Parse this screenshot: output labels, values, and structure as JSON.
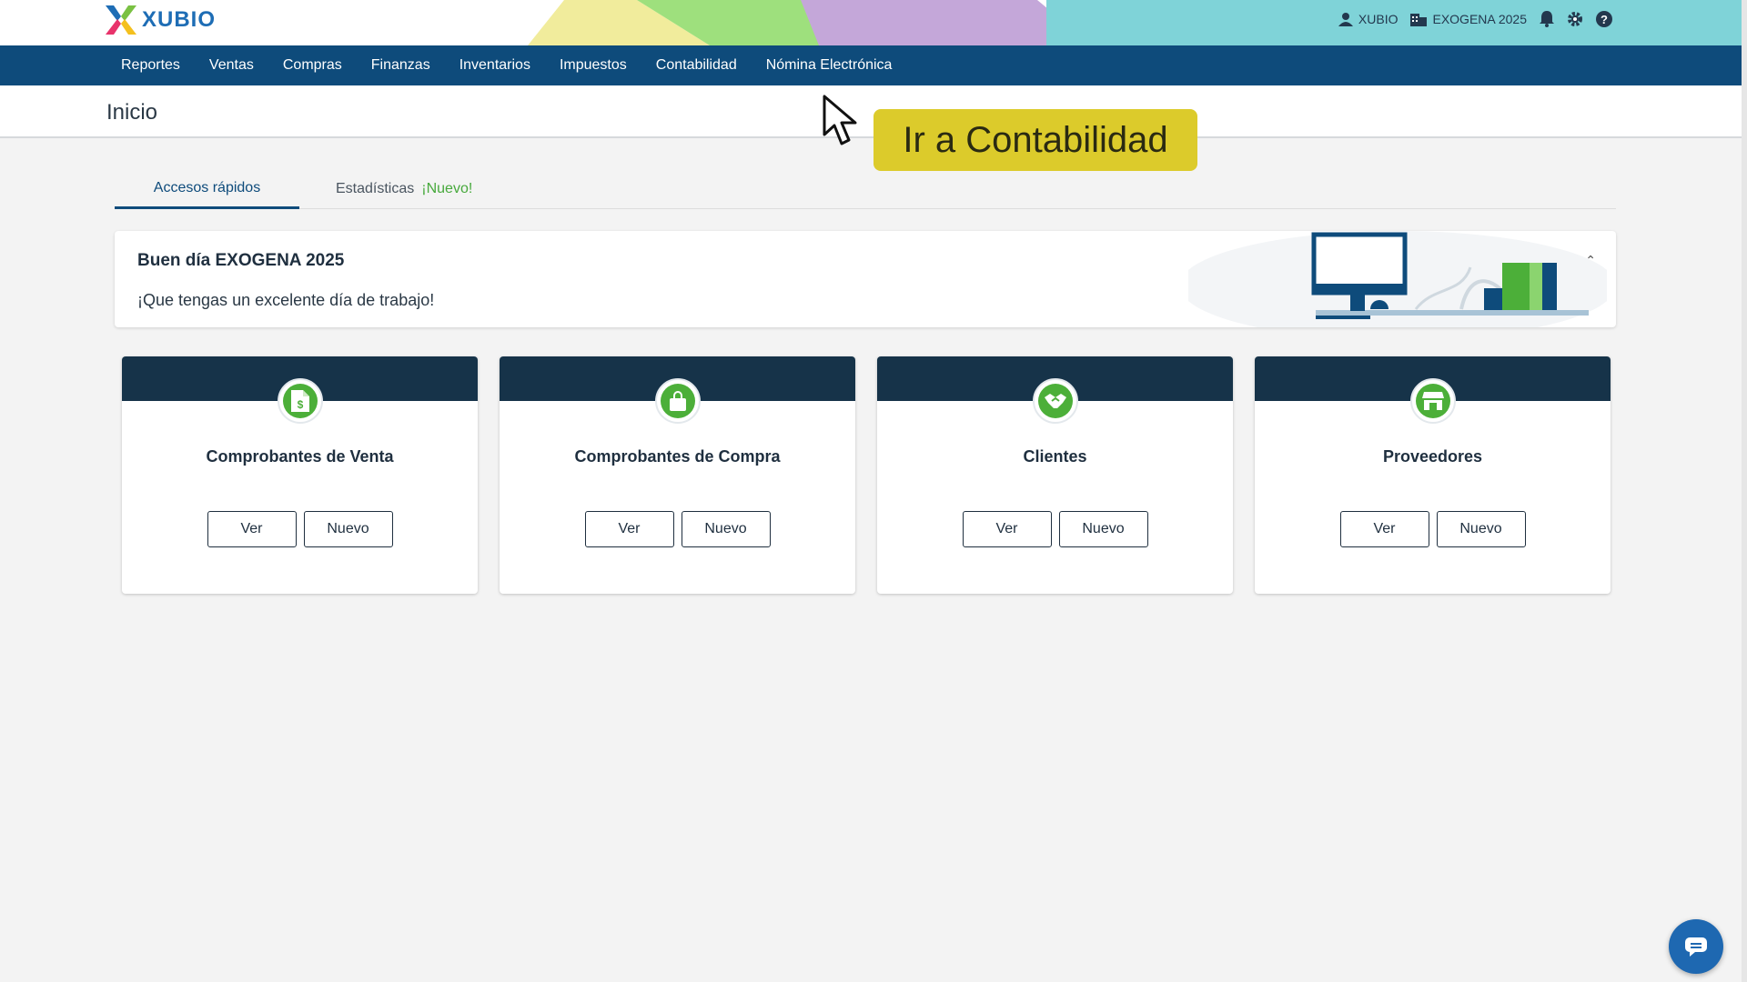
{
  "app": {
    "brand": "XUBIO"
  },
  "header": {
    "user_label": "XUBIO",
    "company_label": "EXOGENA 2025",
    "icons": [
      "user-icon",
      "building-icon",
      "bell-icon",
      "gear-icon",
      "help-icon"
    ]
  },
  "nav": {
    "items": [
      "Reportes",
      "Ventas",
      "Compras",
      "Finanzas",
      "Inventarios",
      "Impuestos",
      "Contabilidad",
      "Nómina Electrónica"
    ]
  },
  "page": {
    "title": "Inicio"
  },
  "tooltip": {
    "text": "Ir a Contabilidad"
  },
  "tabs": {
    "quick": "Accesos rápidos",
    "stats": "Estadísticas",
    "stats_badge": "¡Nuevo!"
  },
  "greeting": {
    "title": "Buen día EXOGENA 2025",
    "message": "¡Que tengas un excelente día de trabajo!"
  },
  "cards": [
    {
      "title": "Comprobantes de Venta",
      "icon": "invoice-icon",
      "view": "Ver",
      "new": "Nuevo"
    },
    {
      "title": "Comprobantes de Compra",
      "icon": "shopping-bag-icon",
      "view": "Ver",
      "new": "Nuevo"
    },
    {
      "title": "Clientes",
      "icon": "handshake-icon",
      "view": "Ver",
      "new": "Nuevo"
    },
    {
      "title": "Proveedores",
      "icon": "store-icon",
      "view": "Ver",
      "new": "Nuevo"
    }
  ],
  "colors": {
    "nav": "#0e4b7b",
    "accent_green": "#4caf39",
    "tooltip": "#dccb2b",
    "card_band": "#163349"
  }
}
